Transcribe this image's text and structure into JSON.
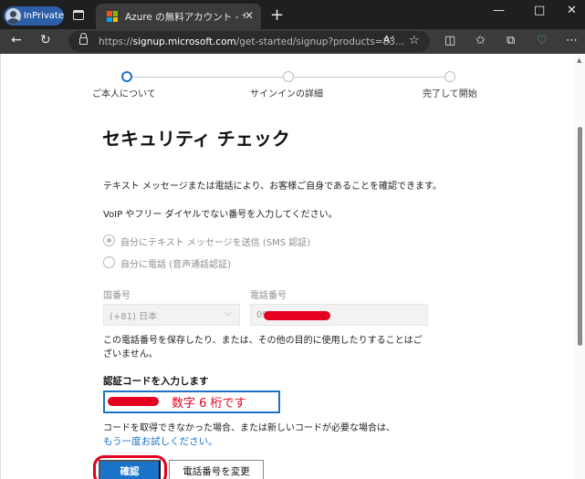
{
  "browser": {
    "inprivate_label": "InPrivate",
    "tab_title": "Azure の無料アカウント - サインアップ",
    "tab_close": "✕",
    "new_tab": "+",
    "url_prefix": "https://",
    "url_host": "signup.microsoft.com",
    "url_rest": "/get-started/signup?products=83...",
    "window_controls": [
      "—",
      "□",
      "✕"
    ],
    "nav_icons": [
      "arrow-left-icon",
      "refresh-icon"
    ],
    "toolbar_icons": [
      "read-aloud-icon",
      "favorite-icon",
      "split-screen-icon",
      "favorites-icon",
      "collections-icon",
      "heart-icon",
      "more-icon"
    ],
    "ms_logo_colors": [
      "#f25022",
      "#7fba00",
      "#00a4ef",
      "#ffb900"
    ]
  },
  "stepper": {
    "steps": [
      "ご本人について",
      "サインインの詳細",
      "完了して開始"
    ],
    "active_index": 0
  },
  "page": {
    "title": "セキュリティ チェック",
    "intro_line1": "テキスト メッセージまたは電話により、お客様ご自身であることを確認できます。",
    "intro_line2": "VoIP やフリー ダイヤルでない番号を入力してください。",
    "radio_sms": "自分にテキスト メッセージを送信 (SMS 認証)",
    "radio_call": "自分に電話 (音声通話認証)",
    "country_label": "国番号",
    "country_value": "(+81) 日本",
    "phone_label": "電話番号",
    "phone_value_visible": "09",
    "privacy_line1": "この電話番号を保存したり、または、その他の目的に使用したりすることはご",
    "privacy_line2": "ざいません。",
    "code_label": "認証コードを入力します",
    "code_annotation": "数字 6 桁です",
    "no_code_text": "コードを取得できなかった場合、または新しいコードが必要な場合は、",
    "retry_link": "もう一度お試しください。",
    "verify_button": "確認",
    "change_phone_button": "電話番号を変更"
  },
  "colors": {
    "accent": "#1a73c8",
    "annotation_red": "#e4001e"
  }
}
